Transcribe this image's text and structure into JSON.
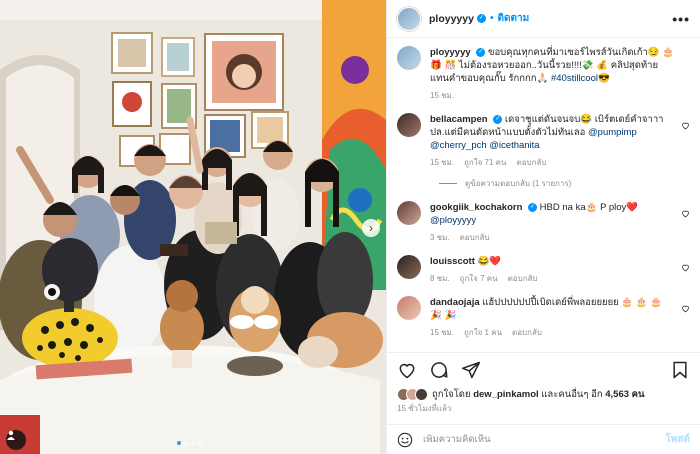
{
  "post": {
    "username": "ployyyyy",
    "follow_label": "ติดตาม",
    "more_label": "•••",
    "caption": {
      "username": "ployyyyy",
      "text": "ขอบคุณทุกคนที่มาเซอร์ไพรส์วันเกิดเก้า😏 🎂 🎁 🎊 ไม่ต้องรอหวยออก..วันนี้รวย!!!!💸 💰 คลิปสุดท้ายแทนคำขอบคุณกั๊บ รักกกก🙏🏻 ",
      "hashtag": "#40stillcool",
      "suffix": "😎",
      "time": "15 ชม."
    },
    "comments": [
      {
        "username": "bellacampen",
        "text": " เดจาชูแต่ดันจนจบ😂 เบิร์ตเดย์คำจาาา ปล.แต่มีคนตัดหน้าแบบตั้งตัวไม่ทันเลอ ",
        "mentions": [
          "@pumpimp",
          "@cherry_pch",
          "@icethanita"
        ],
        "time": "15 ชม.",
        "likes": "ถูกใจ 71 คน",
        "reply": "ตอบกลับ",
        "view_replies": "ดูข้อความตอบกลับ (1 รายการ)"
      },
      {
        "username": "gookgiik_kochakorn",
        "text": " HBD na ka🎂 P ploy❤️ ",
        "mentions": [
          "@ployyyyy"
        ],
        "time": "3 ชม.",
        "reply": "ตอบกลับ"
      },
      {
        "username": "louisscott",
        "text": " 😂❤️",
        "time": "8 ชม.",
        "likes": "ถูกใจ 7 คน",
        "reply": "ตอบกลับ"
      },
      {
        "username": "dandaojaja",
        "text": " แฮ้ปปปปปปปี้เบิดเดย์พี่พลอยยยยย 🎂 🎂 🎂 🎉 🎉",
        "time": "15 ชม.",
        "likes": "ถูกใจ 1 คน",
        "reply": "ตอบกลับ"
      }
    ],
    "likes_prefix": "ถูกใจโดย ",
    "likes_user": "dew_pinkamol",
    "likes_middle": " และคนอื่นๆ อีก ",
    "likes_count": "4,563 คน",
    "time_ago": "15 ชั่วโมงที่แล้ว",
    "add_comment_placeholder": "เพิ่มความคิดเห็น",
    "post_label": "โพสต์"
  },
  "carousel": {
    "slides": 4,
    "active_index": 0
  },
  "colors": {
    "accent": "#0095f6",
    "text": "#262626",
    "muted": "#8e8e8e",
    "like": "#ed4956"
  },
  "icons": [
    "heart-icon",
    "comment-icon",
    "share-icon",
    "bookmark-icon",
    "emoji-icon",
    "verified-icon",
    "tagged-user-icon",
    "chevron-right-icon"
  ]
}
